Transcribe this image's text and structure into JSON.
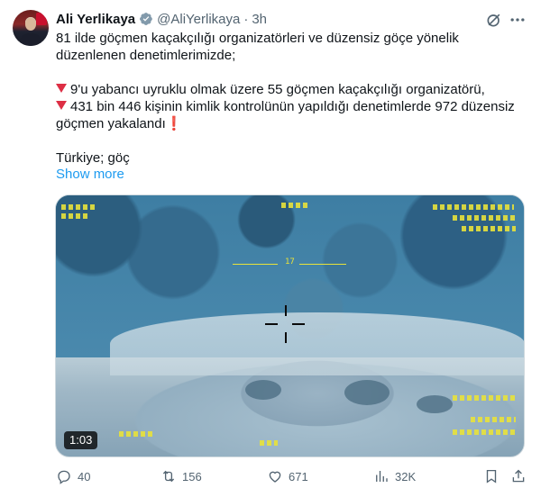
{
  "author": {
    "name": "Ali Yerlikaya",
    "handle": "@AliYerlikaya",
    "separator": "·",
    "time": "3h"
  },
  "tweet": {
    "line1": "81 ilde göçmen kaçakçılığı organizatörleri ve düzensiz göçe yönelik düzenlenen denetimlerimizde;",
    "item1": "9'u yabancı uyruklu olmak üzere 55 göçmen kaçakçılığı organizatörü,",
    "item2": "431 bin 446 kişinin kimlik kontrolünün yapıldığı denetimlerde 972 düzensiz göçmen yakalandı",
    "exclamation": "❗",
    "tags": "Türkiye; göç",
    "show_more": "Show more"
  },
  "media": {
    "duration": "1:03",
    "hud_reading": "17"
  },
  "actions": {
    "replies": "40",
    "reposts": "156",
    "likes": "671",
    "views": "32K"
  },
  "colors": {
    "accent": "#1d9bf0",
    "secondary_text": "#536471",
    "emoji_red": "#dd2e44",
    "hud_yellow": "#e8e23a"
  },
  "icons": [
    "verified-badge-icon",
    "grok-icon",
    "more-icon",
    "reply-icon",
    "repost-icon",
    "like-icon",
    "views-icon",
    "bookmark-icon",
    "share-icon"
  ]
}
